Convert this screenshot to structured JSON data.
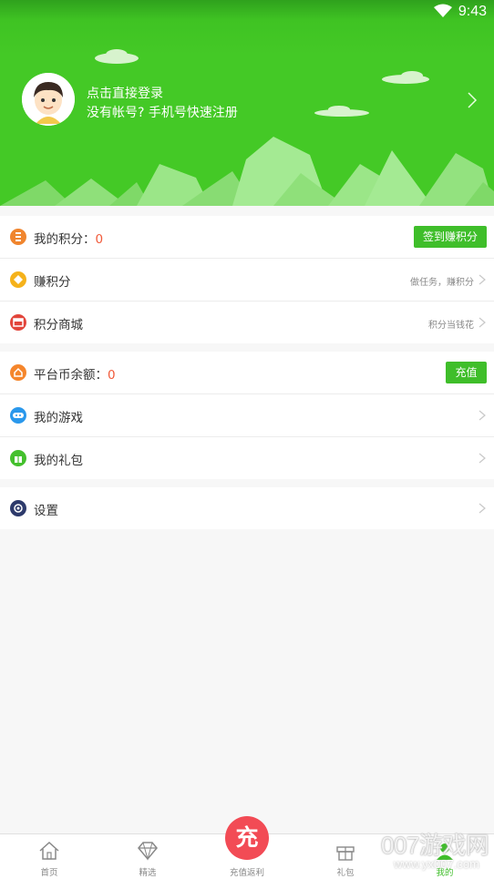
{
  "status_bar": {
    "time": "9:43"
  },
  "header": {
    "login_title": "点击直接登录",
    "login_subtitle": "没有帐号? 手机号快速注册"
  },
  "points_section": {
    "my_points_label": "我的积分：",
    "my_points_value": "0",
    "checkin_button": "签到赚积分",
    "earn_label": "赚积分",
    "earn_hint": "做任务，赚积分",
    "mall_label": "积分商城",
    "mall_hint": "积分当钱花"
  },
  "balance_section": {
    "balance_label": "平台币余额：",
    "balance_value": "0",
    "recharge_button": "充值",
    "games_label": "我的游戏",
    "gifts_label": "我的礼包"
  },
  "settings_section": {
    "settings_label": "设置"
  },
  "tabbar": {
    "home": "首页",
    "featured": "精选",
    "recharge_circle": "充",
    "recharge": "充值返利",
    "gift": "礼包",
    "mine": "我的"
  },
  "watermark": {
    "main": "007游戏网",
    "sub": "www.yx007.com"
  },
  "colors": {
    "brand_green": "#44c926",
    "accent_red": "#f15a3a",
    "charge_red": "#f24b55"
  }
}
